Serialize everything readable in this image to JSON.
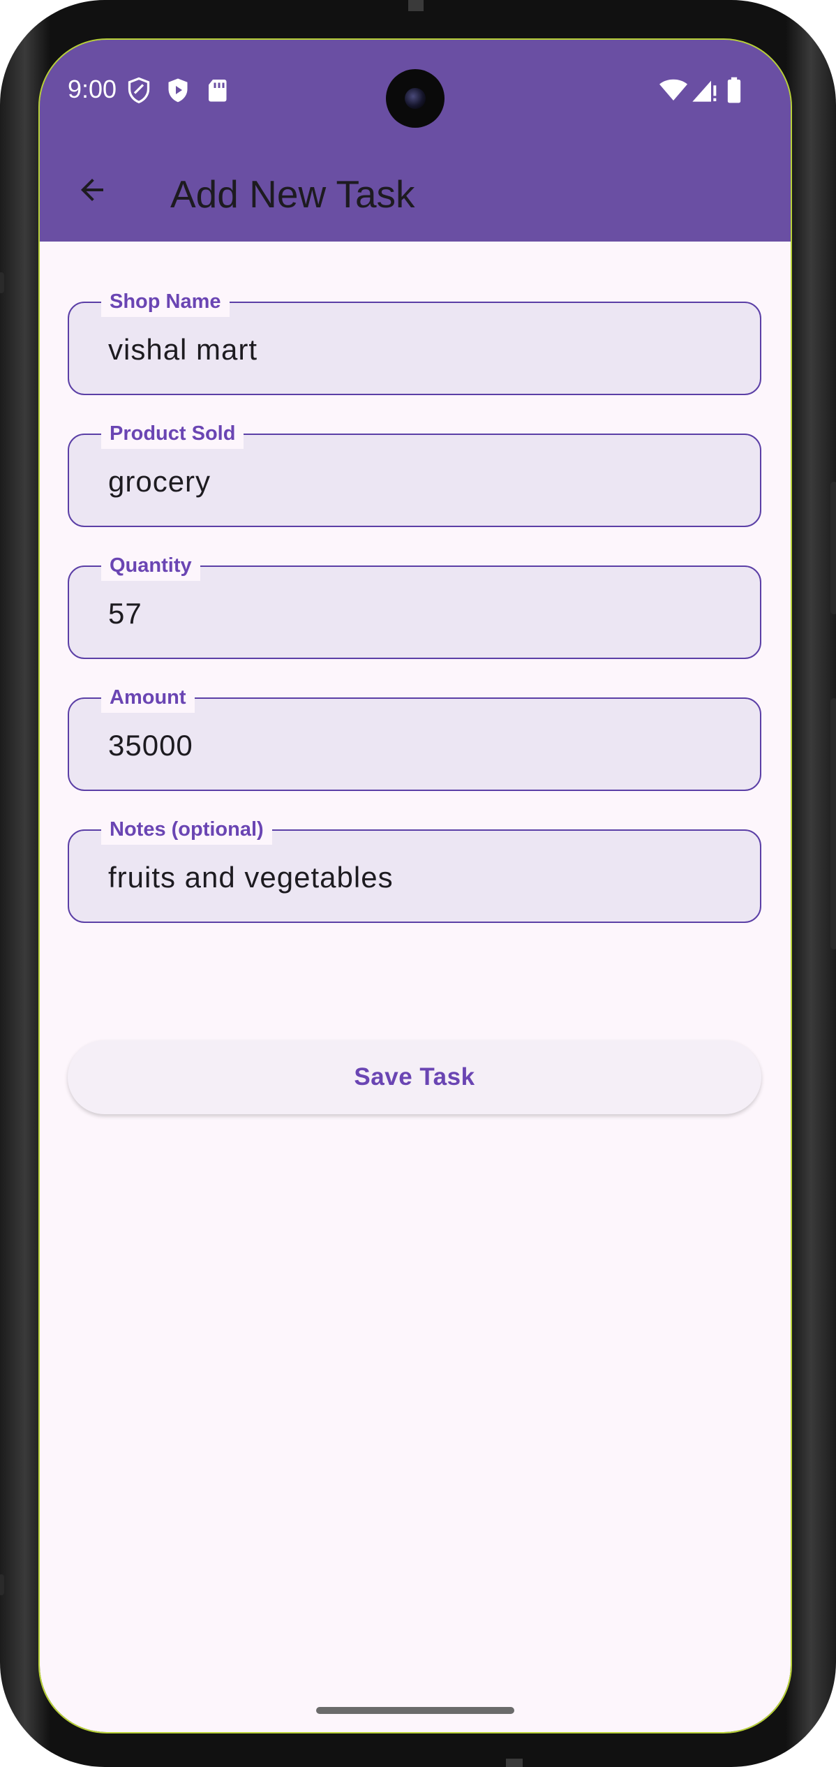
{
  "status_bar": {
    "time": "9:00",
    "icons_left": [
      "shield-outline-icon",
      "play-shield-icon",
      "sd-card-icon"
    ],
    "icons_right": [
      "wifi-icon",
      "cellular-signal-icon",
      "battery-icon"
    ]
  },
  "app_bar": {
    "title": "Add New Task",
    "back_icon": "arrow-back-icon",
    "background_color": "#6a4fa3"
  },
  "form": {
    "fields": [
      {
        "label": "Shop Name",
        "value": "vishal mart"
      },
      {
        "label": "Product Sold",
        "value": "grocery"
      },
      {
        "label": "Quantity",
        "value": "57"
      },
      {
        "label": "Amount",
        "value": "35000"
      },
      {
        "label": "Notes (optional)",
        "value": "fruits and vegetables"
      }
    ],
    "accent_color": "#5b3fa6"
  },
  "actions": {
    "save_label": "Save Task"
  }
}
